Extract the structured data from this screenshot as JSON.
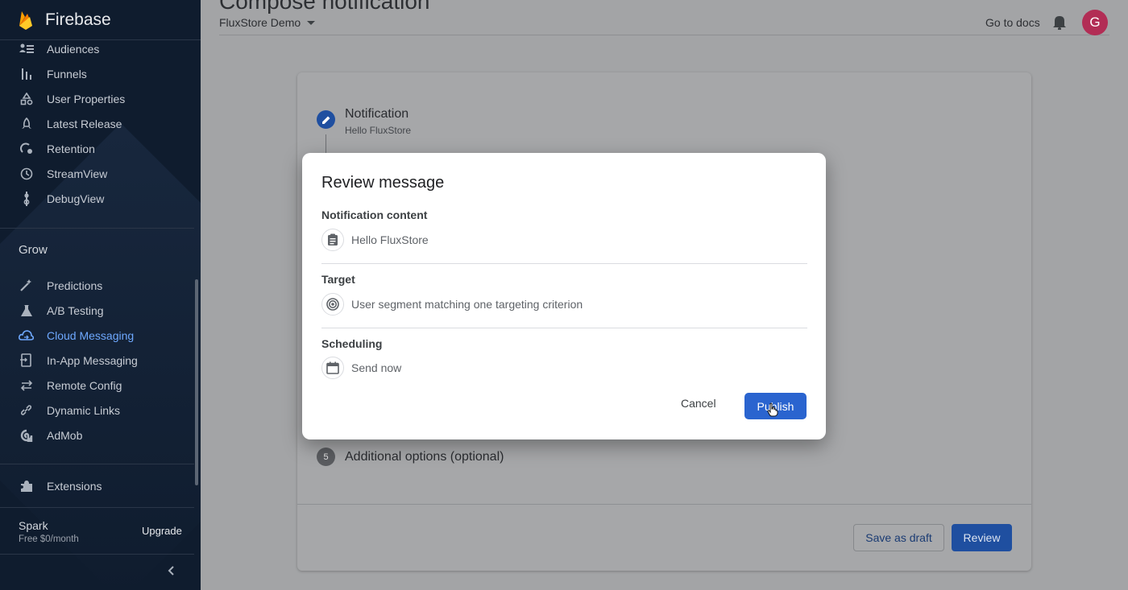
{
  "sidebar": {
    "brand": "Firebase",
    "analytics_items": [
      {
        "label": "Audiences",
        "icon": "audiences-icon"
      },
      {
        "label": "Funnels",
        "icon": "funnels-icon"
      },
      {
        "label": "User Properties",
        "icon": "user-properties-icon"
      },
      {
        "label": "Latest Release",
        "icon": "rocket-icon"
      },
      {
        "label": "Retention",
        "icon": "retention-icon"
      },
      {
        "label": "StreamView",
        "icon": "clock-icon"
      },
      {
        "label": "DebugView",
        "icon": "debug-icon"
      }
    ],
    "grow_title": "Grow",
    "grow_items": [
      {
        "label": "Predictions",
        "icon": "magic-wand-icon"
      },
      {
        "label": "A/B Testing",
        "icon": "flask-icon"
      },
      {
        "label": "Cloud Messaging",
        "icon": "cloud-messaging-icon",
        "active": true
      },
      {
        "label": "In-App Messaging",
        "icon": "in-app-messaging-icon"
      },
      {
        "label": "Remote Config",
        "icon": "remote-config-icon"
      },
      {
        "label": "Dynamic Links",
        "icon": "link-icon"
      },
      {
        "label": "AdMob",
        "icon": "admob-icon"
      }
    ],
    "extensions": {
      "label": "Extensions",
      "icon": "extensions-icon"
    },
    "plan": {
      "name": "Spark",
      "price": "Free $0/month",
      "upgrade": "Upgrade"
    }
  },
  "header": {
    "page_title": "Compose notification",
    "project": "FluxStore Demo",
    "docs_link": "Go to docs",
    "avatar_letter": "G"
  },
  "steps": {
    "step1_title": "Notification",
    "step1_subtitle": "Hello FluxStore",
    "step5_number": "5",
    "step5_title": "Additional options (optional)"
  },
  "footer": {
    "save_draft": "Save as draft",
    "review": "Review"
  },
  "dialog": {
    "title": "Review message",
    "sections": {
      "content_label": "Notification content",
      "content_value": "Hello FluxStore",
      "target_label": "Target",
      "target_value": "User segment matching one targeting criterion",
      "scheduling_label": "Scheduling",
      "scheduling_value": "Send now"
    },
    "cancel": "Cancel",
    "publish": "Publish"
  },
  "colors": {
    "primary": "#2a64cf",
    "sidebar_bg": "#0f1c2e",
    "active_nav": "#6ea8fe",
    "avatar": "#b22d55"
  }
}
